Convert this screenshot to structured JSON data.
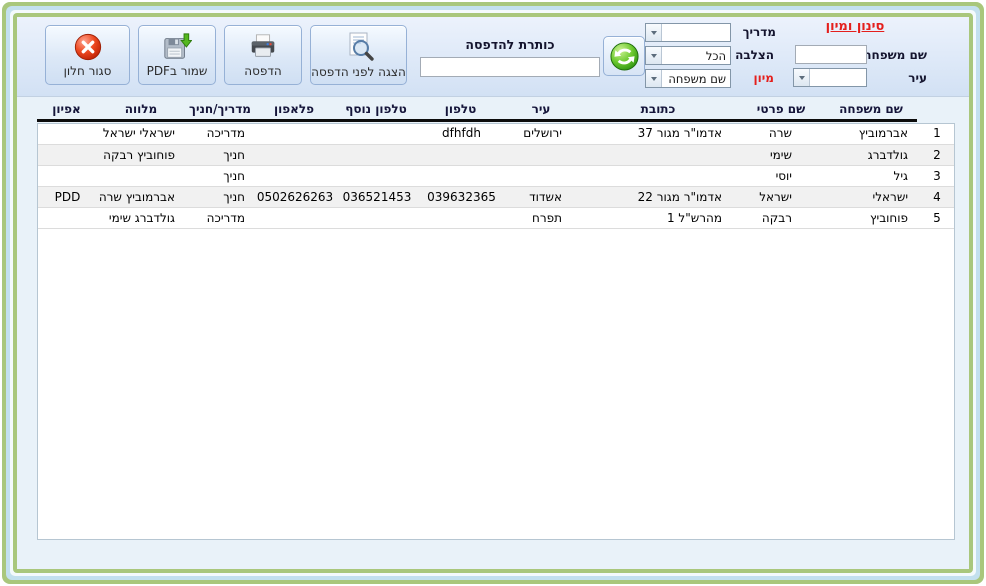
{
  "colors": {
    "accent_red": "#e41f1c",
    "border_green": "#a9c77c",
    "border_blue": "#c3e0ee",
    "topbar_blue": "#d2e1f4"
  },
  "toolbar": {
    "close_label": "סגור חלון",
    "save_pdf_label": "שמור בPDF",
    "print_label": "הדפסה",
    "preview_label": "הצגה לפני הדפסה",
    "print_title_label": "כותרת להדפסה",
    "print_title_value": ""
  },
  "filter": {
    "title": "סינון ומיון",
    "madrich_label": "מדריך",
    "madrich_value": "",
    "cross_label": "הצלבה",
    "cross_value": "הכל",
    "family_label": "שם משפחה",
    "family_value": "",
    "sort_label": "מיון",
    "sort_value": "שם משפחה",
    "city_label": "עיר",
    "city_value": ""
  },
  "table": {
    "col_keys": [
      "num",
      "last_name",
      "first_name",
      "address",
      "city",
      "phone",
      "phone2",
      "mobile",
      "role",
      "companion",
      "profile"
    ],
    "columns": [
      {
        "key": "num",
        "label": ""
      },
      {
        "key": "last_name",
        "label": "שם משפחה"
      },
      {
        "key": "first_name",
        "label": "שם פרטי"
      },
      {
        "key": "address",
        "label": "כתובת"
      },
      {
        "key": "city",
        "label": "עיר"
      },
      {
        "key": "phone",
        "label": "טלפון"
      },
      {
        "key": "phone2",
        "label": "טלפון נוסף"
      },
      {
        "key": "mobile",
        "label": "פלאפון"
      },
      {
        "key": "role",
        "label": "מדריך/חניך"
      },
      {
        "key": "companion",
        "label": "מלווה"
      },
      {
        "key": "profile",
        "label": "אפיון"
      }
    ],
    "rows": [
      {
        "num": "1",
        "last_name": "אברמוביץ",
        "first_name": "שרה",
        "address": "אדמו\"ר מגור 37",
        "city": "ירושלים",
        "phone": "dfhfdh",
        "phone2": "",
        "mobile": "",
        "role": "מדריכה",
        "companion": "ישראלי ישראל",
        "profile": ""
      },
      {
        "num": "2",
        "last_name": "גולדברג",
        "first_name": "שימי",
        "address": "",
        "city": "",
        "phone": "",
        "phone2": "",
        "mobile": "",
        "role": "חניך",
        "companion": "פוחוביץ רבקה",
        "profile": ""
      },
      {
        "num": "3",
        "last_name": "גיל",
        "first_name": "יוסי",
        "address": "",
        "city": "",
        "phone": "",
        "phone2": "",
        "mobile": "",
        "role": "חניך",
        "companion": "",
        "profile": ""
      },
      {
        "num": "4",
        "last_name": "ישראלי",
        "first_name": "ישראל",
        "address": "אדמו\"ר מגור 22",
        "city": "אשדוד",
        "phone": "039632365",
        "phone2": "036521453",
        "mobile": "0502626263",
        "role": "חניך",
        "companion": "אברמוביץ שרה",
        "profile": "PDD"
      },
      {
        "num": "5",
        "last_name": "פוחוביץ",
        "first_name": "רבקה",
        "address": "מהרש\"ל 1",
        "city": "תפרח",
        "phone": "",
        "phone2": "",
        "mobile": "",
        "role": "מדריכה",
        "companion": "גולדברג שימי",
        "profile": ""
      }
    ]
  }
}
